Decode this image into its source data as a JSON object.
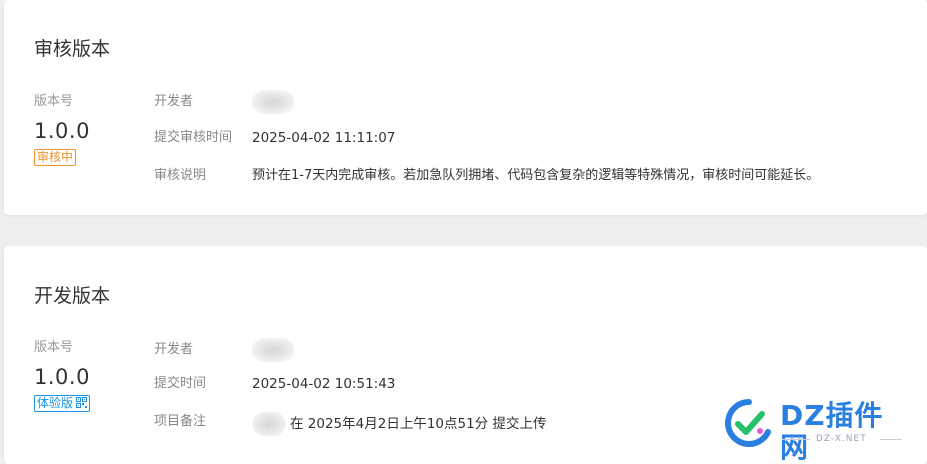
{
  "review_section": {
    "title": "审核版本",
    "version_label": "版本号",
    "version": "1.0.0",
    "status_tag": "审核中",
    "rows": [
      {
        "label": "开发者",
        "value": ""
      },
      {
        "label": "提交审核时间",
        "value": "2025-04-02 11:11:07"
      },
      {
        "label": "审核说明",
        "value": "预计在1-7天内完成审核。若加急队列拥堵、代码包含复杂的逻辑等特殊情况，审核时间可能延长。"
      }
    ]
  },
  "dev_section": {
    "title": "开发版本",
    "version_label": "版本号",
    "version": "1.0.0",
    "status_tag": "体验版",
    "rows": [
      {
        "label": "开发者",
        "value": ""
      },
      {
        "label": "提交时间",
        "value": "2025-04-02 10:51:43"
      },
      {
        "label": "项目备注",
        "value": "在 2025年4月2日上午10点51分 提交上传"
      }
    ]
  },
  "watermark": {
    "brand": "DZ插件网",
    "url": "DZ-X.NET"
  },
  "colors": {
    "review_tag": "#f0932b",
    "trial_tag": "#1b92e8",
    "brand_blue": "#2a7fe0",
    "brand_green": "#27c06a"
  },
  "icons": {
    "trial_qr": "qrcode-icon"
  }
}
